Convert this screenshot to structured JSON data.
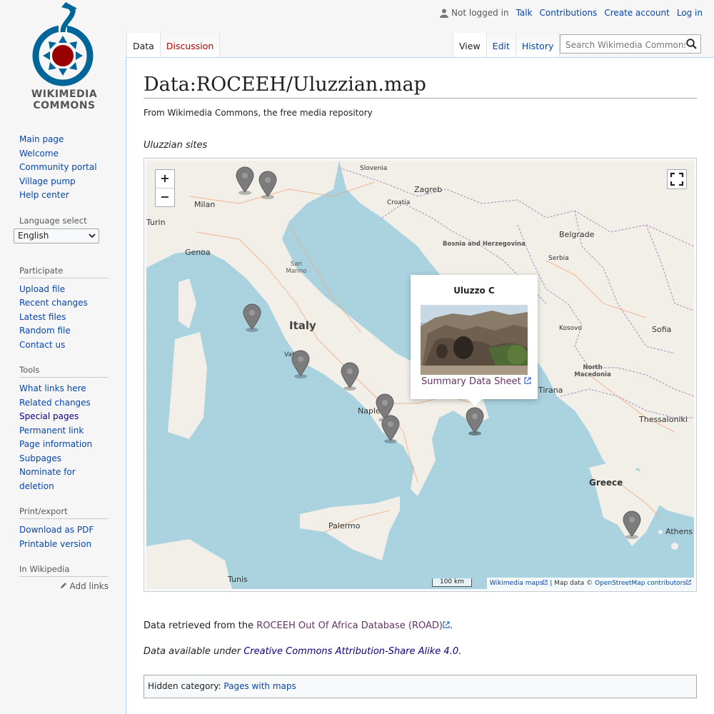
{
  "logo": {
    "line1": "WIKIMEDIA",
    "line2": "COMMONS"
  },
  "personal": {
    "status": "Not logged in",
    "links": [
      "Talk",
      "Contributions",
      "Create account",
      "Log in"
    ]
  },
  "tabs": {
    "left": [
      "Data",
      "Discussion"
    ],
    "right": [
      "View",
      "Edit",
      "History"
    ]
  },
  "search": {
    "placeholder": "Search Wikimedia Commons"
  },
  "sidebar": {
    "main": [
      "Main page",
      "Welcome",
      "Community portal",
      "Village pump",
      "Help center"
    ],
    "language_heading": "Language select",
    "language_value": "English",
    "participate_heading": "Participate",
    "participate": [
      "Upload file",
      "Recent changes",
      "Latest files",
      "Random file",
      "Contact us"
    ],
    "tools_heading": "Tools",
    "tools": [
      "What links here",
      "Related changes",
      "Special pages",
      "Permanent link",
      "Page information",
      "Subpages",
      "Nominate for deletion"
    ],
    "print_heading": "Print/export",
    "print": [
      "Download as PDF",
      "Printable version"
    ],
    "wiki_heading": "In Wikipedia",
    "wiki_add": "Add links"
  },
  "page": {
    "title": "Data:ROCEEH/Uluzzian.map",
    "tagline": "From Wikimedia Commons, the free media repository",
    "map_caption": "Uluzzian sites",
    "retrieved_prefix": "Data retrieved from the ",
    "retrieved_link": "ROCEEH Out Of Africa Database (ROAD)",
    "retrieved_suffix": ".",
    "license_prefix": "Data available under ",
    "license_link": "Creative Commons Attribution-Share Alike 4.0",
    "license_suffix": ".",
    "hidden_category_label": "Hidden category: ",
    "hidden_category": "Pages with maps"
  },
  "map": {
    "zoom_in": "+",
    "zoom_out": "−",
    "popup_title": "Uluzzo C",
    "popup_link": "Summary Data Sheet",
    "scale": "100 km",
    "attribution_maps": "Wikimedia maps",
    "attribution_sep": " | Map data © ",
    "attribution_osm": "OpenStreetMap contributors",
    "labels": {
      "slovenia": "Slovenia",
      "zagreb": "Zagreb",
      "milan": "Milan",
      "turin": "Turin",
      "croatia": "Croatia",
      "belgrade": "Belgrade",
      "genoa": "Genoa",
      "bosnia": "Bosnia and Herzegovina",
      "san_marino": "San Marino",
      "serbia": "Serbia",
      "italy": "Italy",
      "kosovo": "Kosovo",
      "sofia": "Sofia",
      "vatican": "Vatican",
      "north_macedonia": "North Macedonia",
      "naples": "Naples",
      "tirana": "Tirana",
      "thessaloniki": "Thessaloniki",
      "greece": "Greece",
      "palermo": "Palermo",
      "athens": "Athens",
      "tunis": "Tunis"
    }
  }
}
